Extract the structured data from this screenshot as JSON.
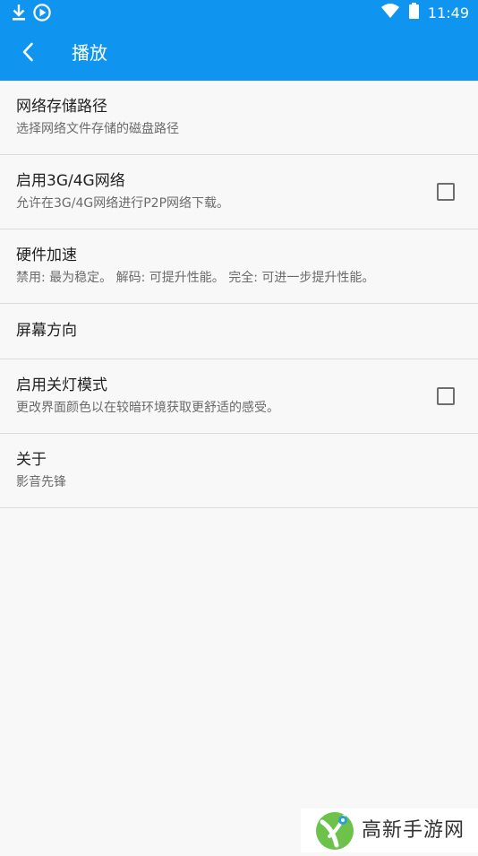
{
  "status_bar": {
    "time": "11:49",
    "left_icons": [
      "download-icon",
      "play-circle-icon"
    ],
    "right_icons": [
      "wifi-icon",
      "battery-icon"
    ]
  },
  "toolbar": {
    "title": "播放",
    "back_icon": "back-arrow-icon"
  },
  "settings": [
    {
      "title": "网络存储路径",
      "summary": "选择网络文件存储的磁盘路径",
      "checkbox": false
    },
    {
      "title": "启用3G/4G网络",
      "summary": "允许在3G/4G网络进行P2P网络下载。",
      "checkbox": true,
      "checked": false
    },
    {
      "title": "硬件加速",
      "summary": "禁用: 最为稳定。 解码: 可提升性能。 完全: 可进一步提升性能。",
      "checkbox": false
    },
    {
      "title": "屏幕方向",
      "checkbox": false
    },
    {
      "title": "启用关灯模式",
      "summary": "更改界面颜色以在较暗环境获取更舒适的感受。",
      "checkbox": true,
      "checked": false
    },
    {
      "title": "关于",
      "summary": "影音先锋",
      "checkbox": false
    }
  ],
  "watermark": {
    "text": "高新手游网"
  },
  "colors": {
    "appbar": "#0f95f0",
    "background": "#f8f8f8",
    "divider": "#dcdcdc",
    "title_text": "#222222",
    "summary_text": "#6a6a6a"
  }
}
